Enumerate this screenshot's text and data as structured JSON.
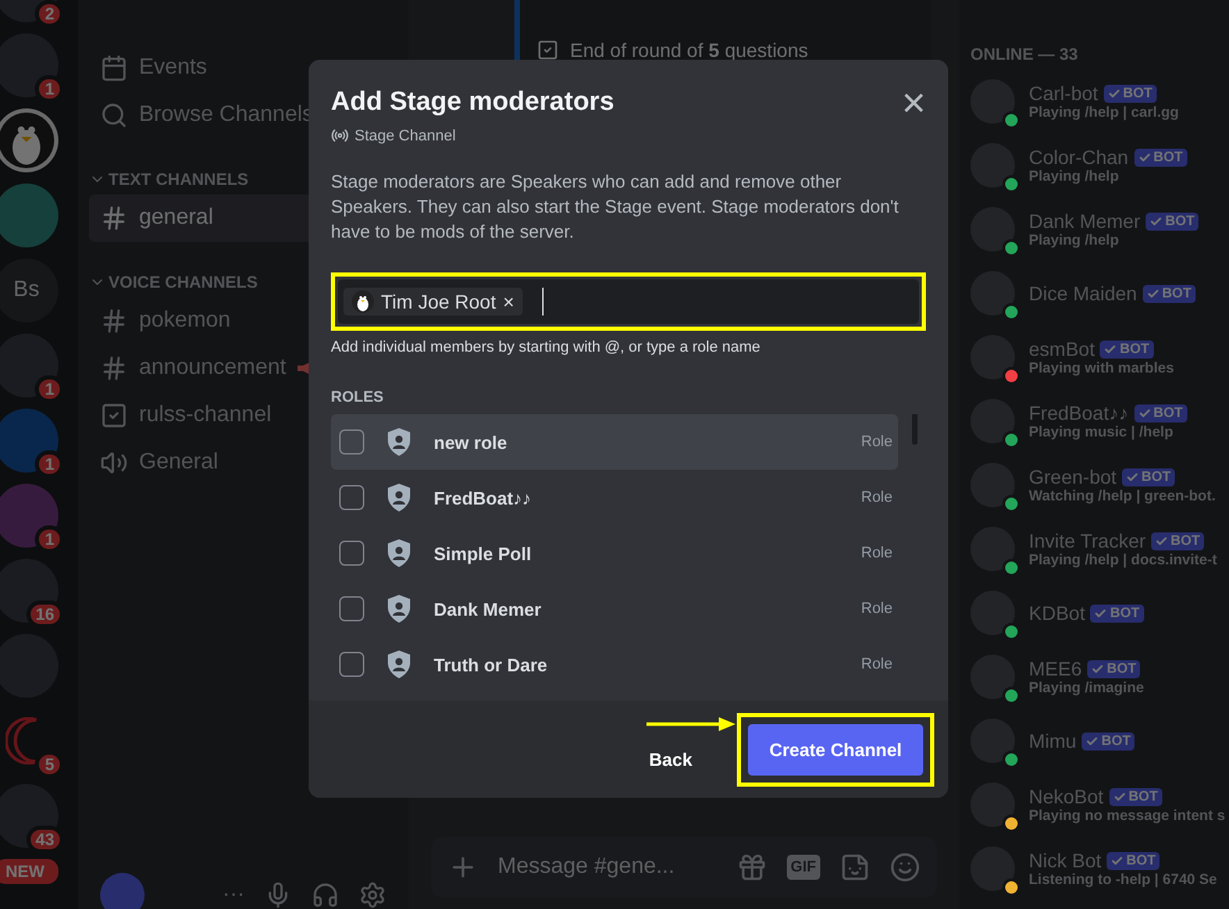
{
  "servers": [
    {
      "kind": "photo",
      "badge": "2"
    },
    {
      "kind": "photo",
      "badge": "1"
    },
    {
      "kind": "penguin"
    },
    {
      "kind": "bucket"
    },
    {
      "kind": "initials",
      "label": "Bs"
    },
    {
      "kind": "photo",
      "badge": "1"
    },
    {
      "kind": "arrow",
      "badge": "1"
    },
    {
      "kind": "gift",
      "badge": "1"
    },
    {
      "kind": "photo",
      "badge": "16"
    },
    {
      "kind": "photo"
    },
    {
      "kind": "moon",
      "badge": "5"
    },
    {
      "kind": "photo",
      "badge": "43"
    },
    {
      "kind": "new",
      "label": "NEW"
    }
  ],
  "sidebar": {
    "top_items": [
      {
        "kind": "events",
        "label": "Events"
      },
      {
        "kind": "browse",
        "label": "Browse Channels"
      }
    ],
    "categories": [
      {
        "label": "TEXT CHANNELS",
        "expanded": true,
        "channels": [
          {
            "kind": "text",
            "name": "general",
            "selected": true,
            "megaphone": false
          }
        ]
      },
      {
        "label": "VOICE CHANNELS",
        "expanded": true,
        "channels": [
          {
            "kind": "text",
            "name": "pokemon",
            "selected": false,
            "megaphone": false
          },
          {
            "kind": "text",
            "name": "announcement",
            "selected": false,
            "megaphone": true
          },
          {
            "kind": "rules",
            "name": "rulss-channel",
            "selected": false,
            "megaphone": false
          },
          {
            "kind": "voice",
            "name": "General",
            "selected": false,
            "megaphone": false
          }
        ]
      }
    ],
    "user_panel": {
      "more": "···"
    }
  },
  "chat": {
    "note": "End of round of **5** questions",
    "message_placeholder": "Message #gene...",
    "gif_label": "GIF"
  },
  "members": {
    "heading": "ONLINE — 33",
    "items": [
      {
        "name": "Carl-bot",
        "bot_tag": "BOT",
        "activity": "Playing /help | carl.gg",
        "color": "#23a55a"
      },
      {
        "name": "Color-Chan",
        "bot_tag": "BOT",
        "activity": "Playing /help",
        "color": "#23a55a"
      },
      {
        "name": "Dank Memer",
        "bot_tag": "BOT",
        "activity": "Playing /help",
        "color": "#23a55a"
      },
      {
        "name": "Dice Maiden",
        "bot_tag": "BOT",
        "color": "#23a55a"
      },
      {
        "name": "esmBot",
        "bot_tag": "BOT",
        "activity": "Playing with marbles",
        "color": "#f23f43"
      },
      {
        "name": "FredBoat♪♪",
        "bot_tag": "BOT",
        "activity": "Playing music | /help",
        "color": "#23a55a"
      },
      {
        "name": "Green-bot",
        "bot_tag": "BOT",
        "activity": "Watching /help | green-bot.",
        "color": "#23a55a"
      },
      {
        "name": "Invite Tracker",
        "bot_tag": "BOT",
        "activity": "Playing /help | docs.invite-t",
        "color": "#23a55a"
      },
      {
        "name": "KDBot",
        "bot_tag": "BOT",
        "color": "#23a55a"
      },
      {
        "name": "MEE6",
        "bot_tag": "BOT",
        "activity": "Playing /imagine",
        "color": "#23a55a"
      },
      {
        "name": "Mimu",
        "bot_tag": "BOT",
        "color": "#23a55a"
      },
      {
        "name": "NekoBot",
        "bot_tag": "BOT",
        "activity": "Playing no message intent s",
        "color": "#f0b232"
      },
      {
        "name": "Nick Bot",
        "bot_tag": "BOT",
        "activity": "Listening to -help | 6740 Se",
        "color": "#f0b232"
      }
    ]
  },
  "modal": {
    "title": "Add Stage moderators",
    "subtitle": "Stage Channel",
    "close": "×",
    "description": "Stage moderators are Speakers who can add and remove other Speakers. They can also start the Stage event. Stage moderators don't have to be mods of the server.",
    "chips": [
      {
        "name": "Tim Joe Root",
        "remove": "×"
      }
    ],
    "hint": "Add individual members by starting with @, or type a role name",
    "roles_heading": "ROLES",
    "roles": [
      {
        "name": "new role",
        "tag": "Role",
        "checked": false,
        "selected": true
      },
      {
        "name": "FredBoat♪♪",
        "tag": "Role",
        "checked": false,
        "selected": false
      },
      {
        "name": "Simple Poll",
        "tag": "Role",
        "checked": false,
        "selected": false
      },
      {
        "name": "Dank Memer",
        "tag": "Role",
        "checked": false,
        "selected": false
      },
      {
        "name": "Truth or Dare",
        "tag": "Role",
        "checked": false,
        "selected": false
      }
    ],
    "back": "Back",
    "create": "Create Channel"
  }
}
